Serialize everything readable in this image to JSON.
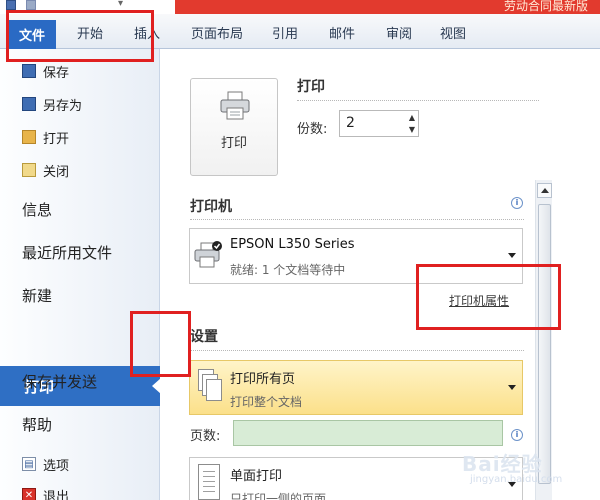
{
  "title_bar": {
    "title_partial": "劳动合同最新版"
  },
  "ribbon_tabs": {
    "file": "文件",
    "items": [
      "开始",
      "插入",
      "页面布局",
      "引用",
      "邮件",
      "审阅",
      "视图"
    ]
  },
  "sidebar": {
    "save": "保存",
    "save_as": "另存为",
    "open": "打开",
    "close": "关闭",
    "info": "信息",
    "recent": "最近所用文件",
    "new": "新建",
    "print": "打印",
    "save_send": "保存并发送",
    "help": "帮助",
    "options": "选项",
    "exit": "退出"
  },
  "print_section": {
    "button_label": "打印",
    "heading": "打印",
    "copies_label": "份数:",
    "copies_value": "2"
  },
  "printer_section": {
    "heading": "打印机",
    "name": "EPSON L350 Series",
    "status": "就绪: 1 个文档等待中",
    "properties_link": "打印机属性"
  },
  "settings_section": {
    "heading": "设置",
    "print_all_title": "打印所有页",
    "print_all_sub": "打印整个文档",
    "pages_label": "页数:",
    "pages_value": "",
    "one_sided_title": "单面打印",
    "one_sided_sub": "只打印一侧的页面"
  },
  "watermark": {
    "main": "Bai经验",
    "sub": "jingyan.baidu.com"
  },
  "colors": {
    "accent": "#2f6fc4",
    "annotation": "#e02020",
    "highlight": "#fbe08a"
  },
  "icons": [
    "save-icon",
    "save-as-icon",
    "open-folder-icon",
    "close-doc-icon",
    "options-icon",
    "exit-icon",
    "printer-icon",
    "info-icon",
    "pages-icon",
    "document-icon"
  ]
}
